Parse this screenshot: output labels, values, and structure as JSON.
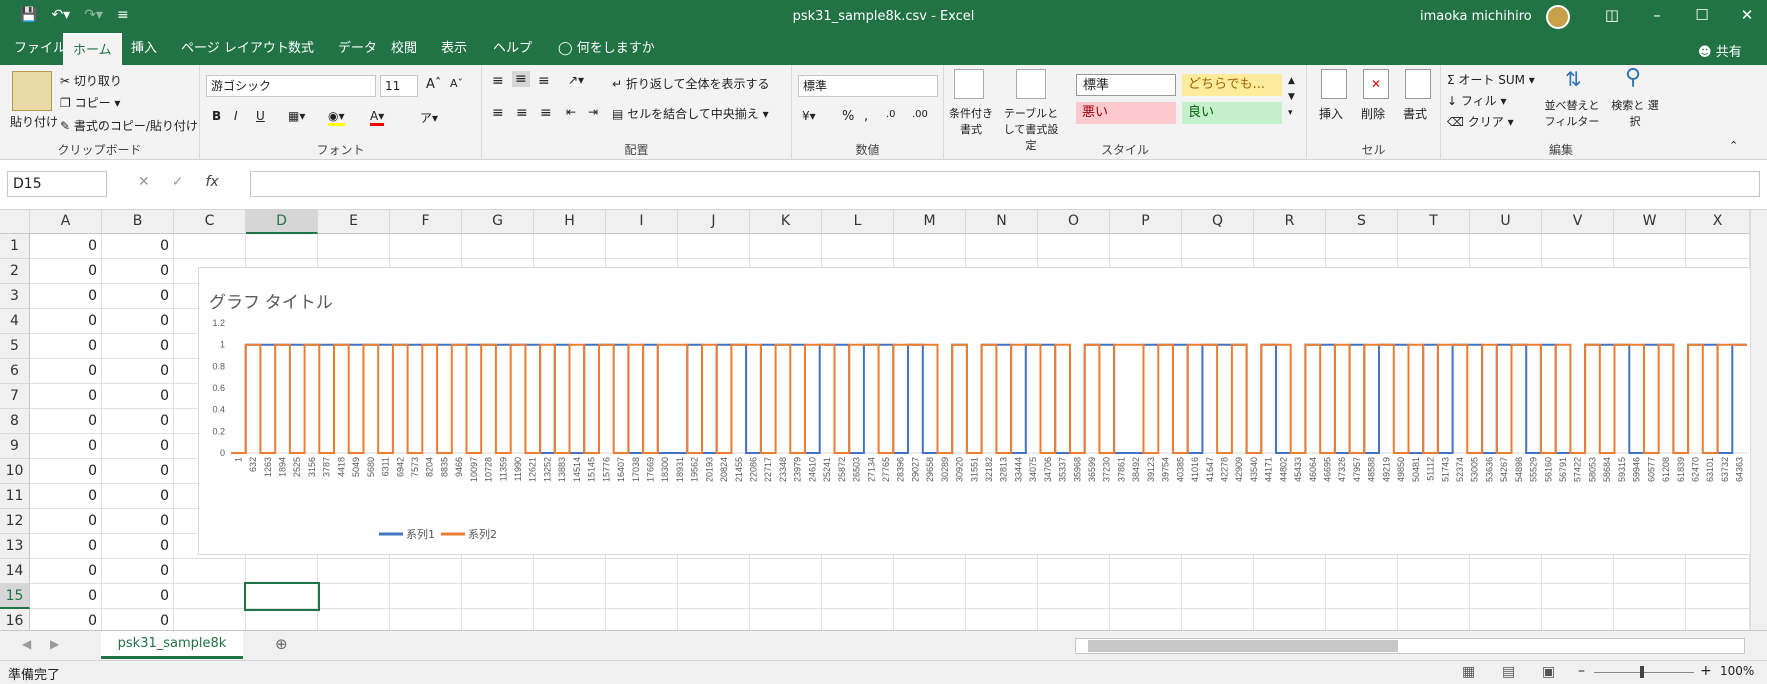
{
  "window": {
    "title": "psk31_sample8k.csv  -  Excel",
    "user": "imaoka michihiro"
  },
  "qat": {
    "save_icon": "save-icon",
    "undo_icon": "undo-icon",
    "redo_icon": "redo-icon",
    "customize_icon": "customize-icon"
  },
  "menu": {
    "tabs": [
      "ファイル",
      "ホーム",
      "挿入",
      "ページ レイアウト",
      "数式",
      "データ",
      "校閲",
      "表示",
      "ヘルプ"
    ],
    "tell_me": "何をしますか",
    "share": "共有"
  },
  "ribbon": {
    "clipboard": {
      "paste": "貼り付け",
      "cut": "切り取り",
      "copy": "コピー",
      "format_painter": "書式のコピー/貼り付け",
      "label": "クリップボード"
    },
    "font": {
      "name": "游ゴシック",
      "size": "11",
      "label": "フォント"
    },
    "alignment": {
      "wrap": "折り返して全体を表示する",
      "merge": "セルを結合して中央揃え",
      "label": "配置"
    },
    "number": {
      "format": "標準",
      "label": "数値"
    },
    "styles": {
      "cond_format": "条件付き書式",
      "table_format": "テーブルとして書式設定",
      "normal": "標準",
      "neutral": "どちらでも...",
      "bad": "悪い",
      "good": "良い",
      "label": "スタイル"
    },
    "cells": {
      "insert": "挿入",
      "delete": "削除",
      "format": "書式",
      "label": "セル"
    },
    "editing": {
      "autosum": "オート SUM",
      "fill": "フィル",
      "clear": "クリア",
      "sort": "並べ替えと フィルター",
      "find": "検索と 選択",
      "label": "編集"
    }
  },
  "formula_bar": {
    "name_box": "D15",
    "fx": "fx",
    "content": ""
  },
  "columns": [
    "A",
    "B",
    "C",
    "D",
    "E",
    "F",
    "G",
    "H",
    "I",
    "J",
    "K",
    "L",
    "M",
    "N",
    "O",
    "P",
    "Q",
    "R",
    "S",
    "T",
    "U",
    "V",
    "W",
    "X"
  ],
  "rows": [
    "1",
    "2",
    "3",
    "4",
    "5",
    "6",
    "7",
    "8",
    "9",
    "10",
    "11",
    "12",
    "13",
    "14",
    "15",
    "16"
  ],
  "cells": {
    "A": [
      "0",
      "0",
      "0",
      "0",
      "0",
      "0",
      "0",
      "0",
      "0",
      "0",
      "0",
      "0",
      "0",
      "0",
      "0",
      "0"
    ],
    "B": [
      "0",
      "0",
      "0",
      "0",
      "0",
      "0",
      "0",
      "0",
      "0",
      "0",
      "0",
      "0",
      "0",
      "0",
      "0",
      "0"
    ]
  },
  "active_cell": "D15",
  "chart_data": {
    "type": "line",
    "title": "グラフ タイトル",
    "y_ticks": [
      "0",
      "0.2",
      "0.4",
      "0.6",
      "0.8",
      "1",
      "1.2"
    ],
    "ylim": [
      0,
      1.2
    ],
    "x_ticks": [
      "1",
      "632",
      "1263",
      "1894",
      "2525",
      "3156",
      "3787",
      "4418",
      "5049",
      "5680",
      "6311",
      "6942",
      "7573",
      "8204",
      "8835",
      "9466",
      "10097",
      "10728",
      "11359",
      "11990",
      "12621",
      "13252",
      "13883",
      "14514",
      "15145",
      "15776",
      "16407",
      "17038",
      "17669",
      "18300",
      "18931",
      "19562",
      "20193",
      "20824",
      "21455",
      "22086",
      "22717",
      "23348",
      "23979",
      "24610",
      "25241",
      "25872",
      "26503",
      "27134",
      "27765",
      "28396",
      "29027",
      "29658",
      "30289",
      "30920",
      "31551",
      "32182",
      "32813",
      "33444",
      "34075",
      "34706",
      "35337",
      "35968",
      "36599",
      "37230",
      "37861",
      "38492",
      "39123",
      "39754",
      "40385",
      "41016",
      "41647",
      "42278",
      "42909",
      "43540",
      "44171",
      "44802",
      "45433",
      "46064",
      "46695",
      "47326",
      "47957",
      "48588",
      "49219",
      "49850",
      "50481",
      "51112",
      "51743",
      "52374",
      "53005",
      "53636",
      "54267",
      "54898",
      "55529",
      "56160",
      "56791",
      "57422",
      "58053",
      "58684",
      "59315",
      "59946",
      "60577",
      "61208",
      "61839",
      "62470",
      "63101",
      "63732",
      "64363"
    ],
    "series": [
      {
        "name": "系列1",
        "color": "#4472C4",
        "values": [
          0,
          1,
          1,
          1,
          1,
          1,
          1,
          1,
          1,
          1,
          1,
          1,
          1,
          1,
          1,
          1,
          1,
          1,
          1,
          1,
          1,
          0,
          1,
          0,
          1,
          1,
          1,
          0,
          1,
          0,
          0,
          1,
          0,
          1,
          1,
          0,
          1,
          1,
          1,
          0,
          1,
          1,
          0,
          1,
          1,
          0,
          1,
          0,
          0,
          1,
          0,
          1,
          1,
          0,
          1,
          1,
          0,
          0,
          1,
          1,
          0,
          0,
          1,
          1,
          1,
          0,
          1,
          1,
          1,
          0,
          1,
          0,
          0,
          1,
          1,
          0,
          1,
          0,
          1,
          1,
          0,
          1,
          0,
          1,
          1,
          0,
          1,
          1,
          0,
          1,
          0,
          0,
          1,
          1,
          1,
          0,
          1,
          1,
          0,
          1,
          1,
          0,
          1
        ]
      },
      {
        "name": "系列2",
        "color": "#ED7D31",
        "values": [
          0,
          1,
          0,
          1,
          0,
          1,
          0,
          1,
          0,
          1,
          0,
          1,
          0,
          1,
          0,
          1,
          0,
          1,
          0,
          1,
          0,
          1,
          0,
          1,
          0,
          1,
          0,
          1,
          0,
          1,
          1,
          0,
          1,
          0,
          1,
          1,
          0,
          1,
          0,
          1,
          1,
          0,
          1,
          1,
          0,
          1,
          1,
          1,
          0,
          1,
          0,
          1,
          0,
          1,
          1,
          0,
          1,
          0,
          1,
          0,
          1,
          1,
          0,
          1,
          0,
          1,
          1,
          0,
          1,
          0,
          1,
          1,
          0,
          1,
          0,
          1,
          0,
          1,
          1,
          0,
          1,
          0,
          1,
          1,
          0,
          1,
          0,
          1,
          1,
          0,
          1,
          0,
          1,
          0,
          1,
          1,
          0,
          1,
          0,
          1,
          0,
          1,
          1
        ]
      }
    ],
    "legend": "bottom"
  },
  "sheet": {
    "tab": "psk31_sample8k"
  },
  "status": {
    "text": "準備完了",
    "zoom": "100%"
  }
}
